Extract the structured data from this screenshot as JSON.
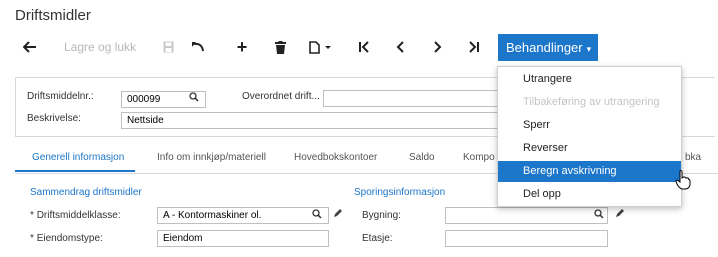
{
  "page": {
    "title": "Driftsmidler"
  },
  "toolbar": {
    "save_close_label": "Lagre og lukk",
    "actions_label": "Behandlinger",
    "actions_caret": "▾"
  },
  "form": {
    "asset_no_label": "Driftsmiddelnr.:",
    "asset_no_value": "000099",
    "parent_asset_label": "Overordnet drift...",
    "parent_asset_value": "",
    "description_label": "Beskrivelse:",
    "description_value": "Nettside"
  },
  "tabs": [
    {
      "label": "Generell informasjon"
    },
    {
      "label": "Info om innkjøp/materiell"
    },
    {
      "label": "Hovedbokskontoer"
    },
    {
      "label": "Saldo"
    },
    {
      "label": "Kompo"
    },
    {
      "label": "bka"
    }
  ],
  "summary": {
    "title": "Sammendrag driftsmidler",
    "class_label": "Driftsmiddelklasse:",
    "class_value": "A - Kontormaskiner ol.",
    "property_type_label": "Eiendomstype:",
    "property_type_value": "Eiendom",
    "required_marker": "*"
  },
  "tracking": {
    "title": "Sporingsinformasjon",
    "building_label": "Bygning:",
    "building_value": "",
    "floor_label": "Etasje:",
    "floor_value": ""
  },
  "menu": {
    "items": [
      {
        "label": "Utrangere",
        "state": "normal"
      },
      {
        "label": "Tilbakeføring av utrangering",
        "state": "disabled"
      },
      {
        "label": "Sperr",
        "state": "normal"
      },
      {
        "label": "Reverser",
        "state": "normal"
      },
      {
        "label": "Beregn avskrivning",
        "state": "highlighted"
      },
      {
        "label": "Del opp",
        "state": "normal"
      }
    ]
  },
  "colors": {
    "accent": "#1c76c9",
    "disabled": "#c4c4c4"
  }
}
